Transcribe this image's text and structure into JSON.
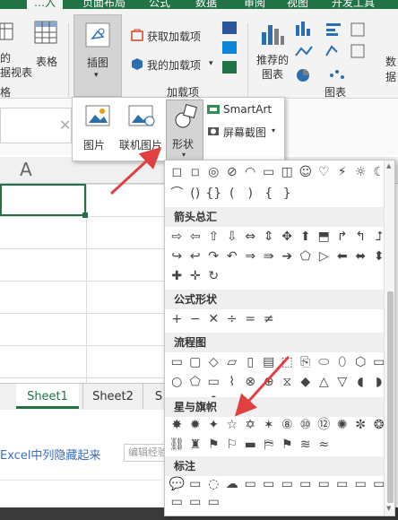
{
  "colors": {
    "excel_green": "#217346",
    "arrow_red": "#e04040"
  },
  "tabs": [
    {
      "label": "…入"
    },
    {
      "label": "页面布局"
    },
    {
      "label": "公式"
    },
    {
      "label": "数据"
    },
    {
      "label": "审阅"
    },
    {
      "label": "视图"
    },
    {
      "label": "开发工具"
    }
  ],
  "ribbon": {
    "pivot_label_1": "的",
    "pivot_label_2": "据视表",
    "table_label": "表格",
    "group_tables": "格",
    "illustrations_label": "插图",
    "get_addins": "获取加载项",
    "my_addins": "我的加载项",
    "group_addins": "加载项",
    "recommended_charts_1": "推荐的",
    "recommended_charts_2": "图表",
    "group_charts": "图表",
    "cut_right": "数据"
  },
  "illustrations_menu": {
    "pictures": "图片",
    "online_pictures": "联机图片",
    "shapes": "形状",
    "smartart": "SmartArt",
    "screenshot": "屏幕截图"
  },
  "sheet": {
    "column_a": "A",
    "tabs": [
      "Sheet1",
      "Sheet2",
      "S"
    ],
    "active_tab_index": 0
  },
  "page_below": {
    "link_text": "Excel中列隐藏起来",
    "edit_label": "编辑经验"
  },
  "shapes_panel": {
    "sections": [
      {
        "title": "箭头总汇"
      },
      {
        "title": "公式形状"
      },
      {
        "title": "流程图"
      },
      {
        "title": "星与旗帜"
      },
      {
        "title": "标注"
      }
    ]
  }
}
